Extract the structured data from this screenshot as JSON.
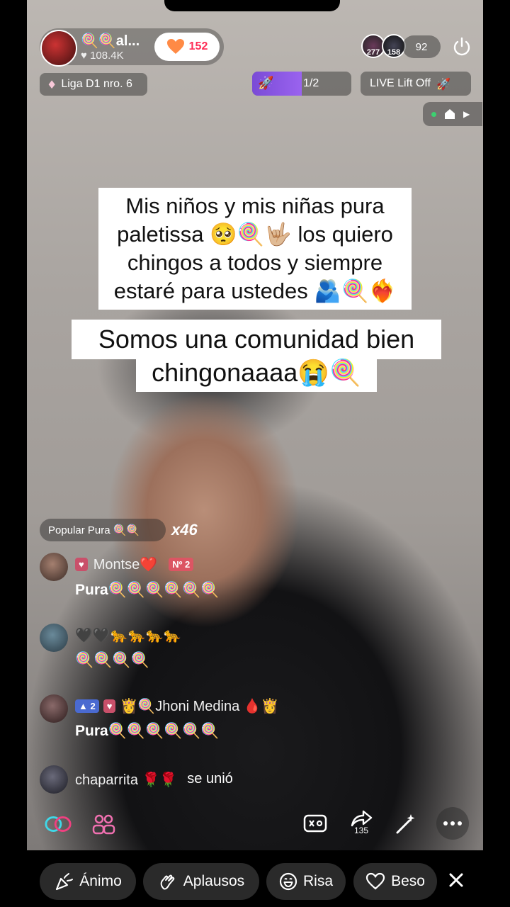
{
  "host": {
    "name": "🍭🍭al...",
    "likes": "108.4K",
    "follow_count": "152"
  },
  "top_viewers": [
    {
      "count": "277"
    },
    {
      "count": "158"
    }
  ],
  "viewer_count": "92",
  "league": "Liga D1 nro. 6",
  "goal": {
    "progress": "1/2",
    "fill_fraction": 0.5
  },
  "event_label": "LIVE Lift Off",
  "captions": [
    [
      "Mis niños y mis niñas pura",
      "paletissa 🥺🍭🤟🏼 los quiero",
      "chingos a todos y siempre",
      "estaré para ustedes 🫂🍭❤️‍🔥"
    ],
    [
      "Somos una comunidad bien",
      "chingonaaaa😭🍭"
    ]
  ],
  "gift_banner": {
    "label": "Popular Pura 🍭🍭",
    "combo": "x46"
  },
  "comments": [
    {
      "name": "Montse❤️",
      "badges": [
        "♥",
        "Nº 2"
      ],
      "text": "Pura🍭🍭🍭🍭🍭🍭",
      "avatar_color": "#6b5348"
    },
    {
      "name": "🖤🖤🐆🐆🐆🐆",
      "badges": [],
      "text": "🍭🍭🍭🍭",
      "avatar_color": "#4a6a7a"
    },
    {
      "name": "👸🍭Jhoni Medina 🩸👸",
      "badges": [
        "▲ 2",
        "♥"
      ],
      "text": "Pura🍭🍭🍭🍭🍭🍭",
      "avatar_color": "#5a3a3a"
    },
    {
      "name": "chaparrita 🌹🌹",
      "joined": "se unió",
      "avatar_color": "#3a3a4a"
    }
  ],
  "share_count": "135",
  "reactions": [
    "Ánimo",
    "Aplausos",
    "Risa",
    "Beso"
  ]
}
